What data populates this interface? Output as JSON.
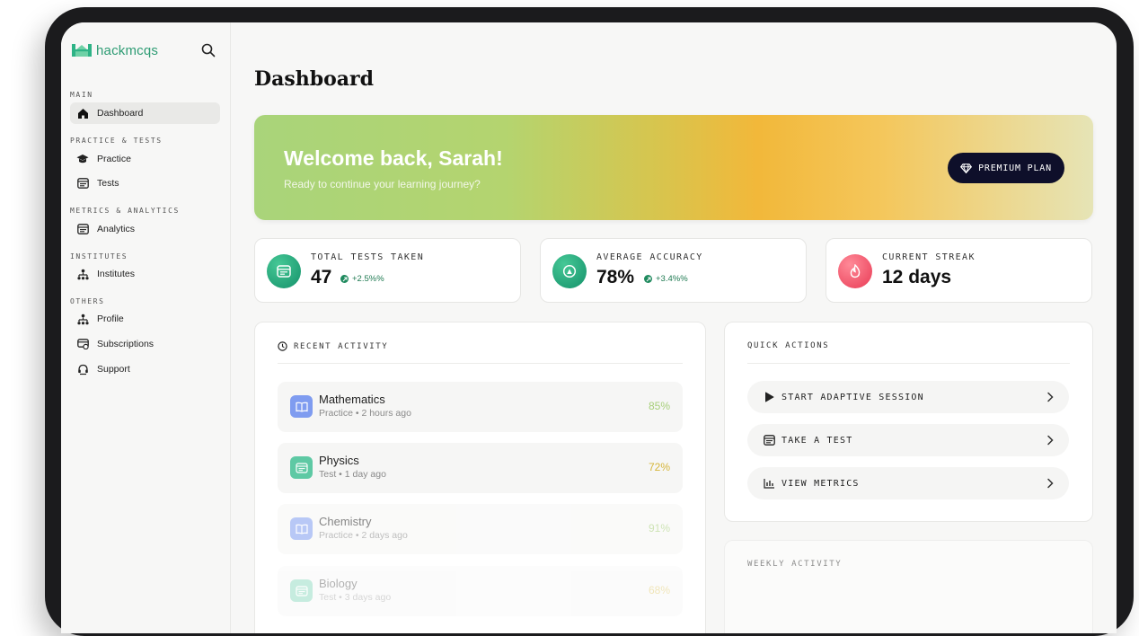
{
  "brand": {
    "name": "hackmcqs"
  },
  "sidebar": {
    "sections": [
      {
        "title": "MAIN",
        "items": [
          {
            "label": "Dashboard",
            "icon": "home-icon",
            "active": true
          }
        ]
      },
      {
        "title": "PRACTICE & TESTS",
        "items": [
          {
            "label": "Practice",
            "icon": "graduation-cap-icon"
          },
          {
            "label": "Tests",
            "icon": "test-sheet-icon"
          }
        ]
      },
      {
        "title": "METRICS & ANALYTICS",
        "items": [
          {
            "label": "Analytics",
            "icon": "analytics-icon"
          }
        ]
      },
      {
        "title": "INSTITUTES",
        "items": [
          {
            "label": "Institutes",
            "icon": "institute-icon"
          }
        ]
      },
      {
        "title": "OTHERS",
        "items": [
          {
            "label": "Profile",
            "icon": "profile-icon"
          },
          {
            "label": "Subscriptions",
            "icon": "subscriptions-icon"
          },
          {
            "label": "Support",
            "icon": "support-icon"
          }
        ]
      }
    ]
  },
  "page": {
    "title": "Dashboard"
  },
  "welcome": {
    "title": "Welcome back, Sarah!",
    "subtitle": "Ready to continue your learning journey?",
    "plan_label": "PREMIUM PLAN"
  },
  "stats": [
    {
      "label": "TOTAL TESTS TAKEN",
      "value": "47",
      "delta": "+2.5%%",
      "icon": "test-sheet-icon",
      "color": "#1a9a72"
    },
    {
      "label": "AVERAGE ACCURACY",
      "value": "78%",
      "delta": "+3.4%%",
      "icon": "gauge-icon",
      "color": "#1a9a72"
    },
    {
      "label": "CURRENT STREAK",
      "value": "12 days",
      "icon": "flame-icon",
      "color": "#ef5267"
    }
  ],
  "recent_activity": {
    "title": "RECENT ACTIVITY",
    "items": [
      {
        "subject": "Mathematics",
        "type": "Practice",
        "time": "2 hours ago",
        "score": "85%",
        "score_color": "#a7cf7a",
        "icon": "book-icon",
        "icon_color": "#7f9cf0"
      },
      {
        "subject": "Physics",
        "type": "Test",
        "time": "1 day ago",
        "score": "72%",
        "score_color": "#d6b63a",
        "icon": "test-sheet-icon",
        "icon_color": "#5ec9a4"
      },
      {
        "subject": "Chemistry",
        "type": "Practice",
        "time": "2 days ago",
        "score": "91%",
        "score_color": "#a7cf7a",
        "icon": "book-icon",
        "icon_color": "#7f9cf0"
      },
      {
        "subject": "Biology",
        "type": "Test",
        "time": "3 days ago",
        "score": "68%",
        "score_color": "#d6b63a",
        "icon": "test-sheet-icon",
        "icon_color": "#5ec9a4"
      }
    ]
  },
  "quick_actions": {
    "title": "QUICK ACTIONS",
    "items": [
      {
        "label": "START ADAPTIVE SESSION",
        "icon": "play-icon"
      },
      {
        "label": "TAKE A TEST",
        "icon": "test-sheet-icon"
      },
      {
        "label": "VIEW METRICS",
        "icon": "bar-chart-icon"
      }
    ]
  },
  "weekly_activity": {
    "title": "WEEKLY ACTIVITY"
  }
}
